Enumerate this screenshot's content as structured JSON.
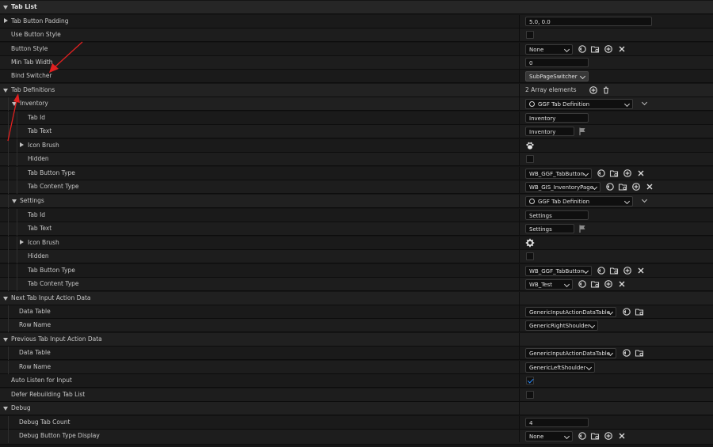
{
  "rows": {
    "tab_list": {
      "label": "Tab List"
    },
    "tab_button_padding": {
      "label": "Tab Button Padding",
      "value": "5.0, 0.0"
    },
    "use_button_style": {
      "label": "Use Button Style"
    },
    "button_style": {
      "label": "Button Style",
      "value": "None"
    },
    "min_tab_width": {
      "label": "Min Tab Width",
      "value": "0"
    },
    "bind_switcher": {
      "label": "Bind Switcher",
      "value": "SubPageSwitcher"
    },
    "tab_definitions": {
      "label": "Tab Definitions",
      "value": "2 Array elements"
    },
    "inventory": {
      "label": "Inventory",
      "value": "GGF Tab Definition"
    },
    "inv_tab_id": {
      "label": "Tab Id",
      "value": "Inventory"
    },
    "inv_tab_text": {
      "label": "Tab Text",
      "value": "Inventory"
    },
    "inv_icon_brush": {
      "label": "Icon Brush"
    },
    "inv_hidden": {
      "label": "Hidden"
    },
    "inv_tab_button_type": {
      "label": "Tab Button Type",
      "value": "WB_GGF_TabButton"
    },
    "inv_tab_content_type": {
      "label": "Tab Content Type",
      "value": "WB_GIS_InventoryPage"
    },
    "settings": {
      "label": "Settings",
      "value": "GGF Tab Definition"
    },
    "set_tab_id": {
      "label": "Tab Id",
      "value": "Settings"
    },
    "set_tab_text": {
      "label": "Tab Text",
      "value": "Settings"
    },
    "set_icon_brush": {
      "label": "Icon Brush"
    },
    "set_hidden": {
      "label": "Hidden"
    },
    "set_tab_button_type": {
      "label": "Tab Button Type",
      "value": "WB_GGF_TabButton"
    },
    "set_tab_content_type": {
      "label": "Tab Content Type",
      "value": "WB_Test"
    },
    "next_tab_input": {
      "label": "Next Tab Input Action Data"
    },
    "next_data_table": {
      "label": "Data Table",
      "value": "GenericInputActionDataTable"
    },
    "next_row_name": {
      "label": "Row Name",
      "value": "GenericRightShoulder"
    },
    "prev_tab_input": {
      "label": "Previous Tab Input Action Data"
    },
    "prev_data_table": {
      "label": "Data Table",
      "value": "GenericInputActionDataTable"
    },
    "prev_row_name": {
      "label": "Row Name",
      "value": "GenericLeftShoulder"
    },
    "auto_listen": {
      "label": "Auto Listen for Input",
      "checked": true
    },
    "defer_rebuilding": {
      "label": "Defer Rebuilding Tab List"
    },
    "debug": {
      "label": "Debug"
    },
    "debug_tab_count": {
      "label": "Debug Tab Count",
      "value": "4"
    },
    "debug_button_type": {
      "label": "Debug Button Type Display",
      "value": "None"
    }
  },
  "colors": {
    "accent": "#2a8cff",
    "annotation_arrow": "#e02020"
  },
  "icons": [
    "reset-arrow-icon",
    "browse-folder-icon",
    "add-circle-icon",
    "clear-x-icon",
    "trash-icon",
    "flag-icon",
    "paw-icon",
    "gear-icon"
  ]
}
